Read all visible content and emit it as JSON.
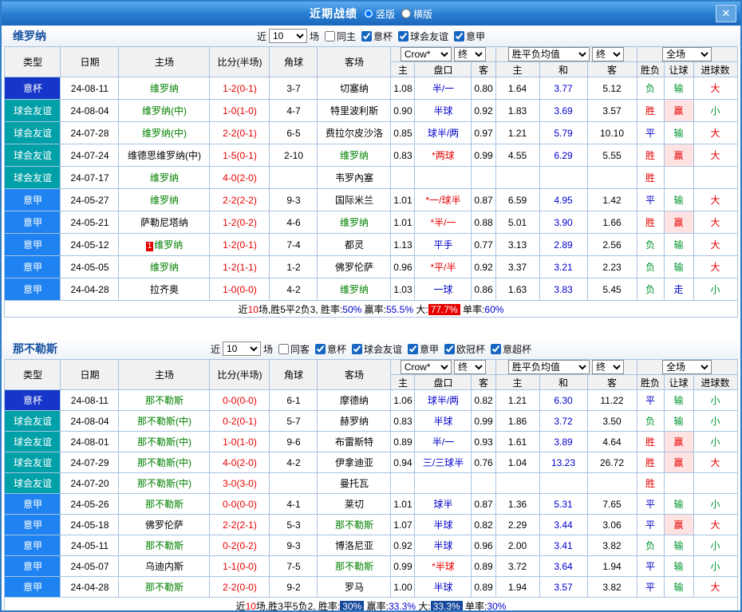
{
  "window": {
    "title": "近期战绩",
    "view_modes": [
      {
        "label": "竖版",
        "selected": true
      },
      {
        "label": "横版",
        "selected": false
      }
    ],
    "close_glyph": "✕"
  },
  "colors": {
    "type_badges": {
      "意杯": "#1536c8",
      "球会友谊": "#00a0a8",
      "意甲": "#1e82f0"
    }
  },
  "table_header": {
    "cols": [
      "类型",
      "日期",
      "主场",
      "比分(半场)",
      "角球",
      "客场"
    ],
    "odds_sub": [
      "主",
      "盘口",
      "客"
    ],
    "avg_sub": [
      "主",
      "和",
      "客"
    ],
    "result_sub": [
      "胜负",
      "让球",
      "进球数"
    ]
  },
  "sections": [
    {
      "team": "维罗纳",
      "filter": {
        "near": "近",
        "count": "10",
        "games": "场",
        "same": "同主",
        "same_checked": false,
        "leagues": [
          {
            "label": "意杯",
            "checked": true
          },
          {
            "label": "球会友谊",
            "checked": true
          },
          {
            "label": "意甲",
            "checked": true
          }
        ]
      },
      "selects": {
        "company": "Crow*",
        "final_a": "终",
        "avg": "胜平负均值",
        "final_b": "终",
        "scope": "全场"
      },
      "rows": [
        {
          "type": "意杯",
          "date": "24-08-11",
          "home": "维罗纳",
          "home_hl": true,
          "score": "1-2(0-1)",
          "corner": "3-7",
          "away": "切塞纳",
          "o1": "1.08",
          "line": "半/一",
          "o2": "0.80",
          "a1": "1.64",
          "a2": "3.77",
          "a3": "5.12",
          "res": "负",
          "let": "输",
          "goal": "大"
        },
        {
          "type": "球会友谊",
          "date": "24-08-04",
          "home": "维罗纳(中)",
          "home_hl": true,
          "score": "1-0(1-0)",
          "corner": "4-7",
          "away": "特里波利斯",
          "o1": "0.90",
          "line": "半球",
          "o2": "0.92",
          "a1": "1.83",
          "a2": "3.69",
          "a3": "3.57",
          "res": "胜",
          "let": "赢",
          "goal": "小"
        },
        {
          "type": "球会友谊",
          "date": "24-07-28",
          "home": "维罗纳(中)",
          "home_hl": true,
          "score": "2-2(0-1)",
          "corner": "6-5",
          "away": "费拉尔皮沙洛",
          "o1": "0.85",
          "line": "球半/两",
          "o2": "0.97",
          "a1": "1.21",
          "a2": "5.79",
          "a3": "10.10",
          "res": "平",
          "let": "输",
          "goal": "大"
        },
        {
          "type": "球会友谊",
          "date": "24-07-24",
          "home": "维德思维罗纳(中)",
          "score": "1-5(0-1)",
          "corner": "2-10",
          "away": "维罗纳",
          "away_hl": true,
          "o1": "0.83",
          "line": "*两球",
          "o2": "0.99",
          "a1": "4.55",
          "a2": "6.29",
          "a3": "5.55",
          "res": "胜",
          "let": "赢",
          "goal": "大"
        },
        {
          "type": "球会友谊",
          "date": "24-07-17",
          "home": "维罗纳",
          "home_hl": true,
          "score": "4-0(2-0)",
          "corner": "",
          "away": "韦罗內塞",
          "res": "胜"
        },
        {
          "type": "意甲",
          "date": "24-05-27",
          "home": "维罗纳",
          "home_hl": true,
          "score": "2-2(2-2)",
          "corner": "9-3",
          "away": "国际米兰",
          "o1": "1.01",
          "line": "*一/球半",
          "o2": "0.87",
          "a1": "6.59",
          "a2": "4.95",
          "a3": "1.42",
          "res": "平",
          "let": "输",
          "goal": "大"
        },
        {
          "type": "意甲",
          "date": "24-05-21",
          "home": "萨勒尼塔纳",
          "score": "1-2(0-2)",
          "corner": "4-6",
          "away": "维罗纳",
          "away_hl": true,
          "o1": "1.01",
          "line": "*半/一",
          "o2": "0.88",
          "a1": "5.01",
          "a2": "3.90",
          "a3": "1.66",
          "res": "胜",
          "let": "赢",
          "goal": "大"
        },
        {
          "type": "意甲",
          "date": "24-05-12",
          "home": "维罗纳",
          "home_hl": true,
          "badge": "1",
          "score": "1-2(0-1)",
          "corner": "7-4",
          "away": "都灵",
          "o1": "1.13",
          "line": "平手",
          "o2": "0.77",
          "a1": "3.13",
          "a2": "2.89",
          "a3": "2.56",
          "res": "负",
          "let": "输",
          "goal": "大"
        },
        {
          "type": "意甲",
          "date": "24-05-05",
          "home": "维罗纳",
          "home_hl": true,
          "score": "1-2(1-1)",
          "corner": "1-2",
          "away": "佛罗伦萨",
          "o1": "0.96",
          "line": "*平/半",
          "o2": "0.92",
          "a1": "3.37",
          "a2": "3.21",
          "a3": "2.23",
          "res": "负",
          "let": "输",
          "goal": "大"
        },
        {
          "type": "意甲",
          "date": "24-04-28",
          "home": "拉齐奥",
          "score": "1-0(0-0)",
          "corner": "4-2",
          "away": "维罗纳",
          "away_hl": true,
          "o1": "1.03",
          "line": "一球",
          "o2": "0.86",
          "a1": "1.63",
          "a2": "3.83",
          "a3": "5.45",
          "res": "负",
          "let": "走",
          "goal": "小"
        }
      ],
      "summary": [
        {
          "t": "近"
        },
        {
          "t": "10",
          "s": "red"
        },
        {
          "t": "场,胜5平2负3, 胜率:"
        },
        {
          "t": "50%",
          "s": "blue"
        },
        {
          "t": " 赢率:"
        },
        {
          "t": "55.5%",
          "s": "blue"
        },
        {
          "t": " 大:"
        },
        {
          "t": "77.7%",
          "s": "redbg"
        },
        {
          "t": " 单率:"
        },
        {
          "t": "60%",
          "s": "blue"
        }
      ]
    },
    {
      "team": "那不勒斯",
      "filter": {
        "near": "近",
        "count": "10",
        "games": "场",
        "same": "同客",
        "same_checked": false,
        "leagues": [
          {
            "label": "意杯",
            "checked": true
          },
          {
            "label": "球会友谊",
            "checked": true
          },
          {
            "label": "意甲",
            "checked": true
          },
          {
            "label": "欧冠杯",
            "checked": true
          },
          {
            "label": "意超杯",
            "checked": true
          }
        ]
      },
      "selects": {
        "company": "Crow*",
        "final_a": "终",
        "avg": "胜平负均值",
        "final_b": "终",
        "scope": "全场"
      },
      "rows": [
        {
          "type": "意杯",
          "date": "24-08-11",
          "home": "那不勒斯",
          "home_hl": true,
          "score": "0-0(0-0)",
          "corner": "6-1",
          "away": "摩德纳",
          "o1": "1.06",
          "line": "球半/两",
          "o2": "0.82",
          "a1": "1.21",
          "a2": "6.30",
          "a3": "11.22",
          "res": "平",
          "let": "输",
          "goal": "小"
        },
        {
          "type": "球会友谊",
          "date": "24-08-04",
          "home": "那不勒斯(中)",
          "home_hl": true,
          "score": "0-2(0-1)",
          "corner": "5-7",
          "away": "赫罗纳",
          "o1": "0.83",
          "line": "半球",
          "o2": "0.99",
          "a1": "1.86",
          "a2": "3.72",
          "a3": "3.50",
          "res": "负",
          "let": "输",
          "goal": "小"
        },
        {
          "type": "球会友谊",
          "date": "24-08-01",
          "home": "那不勒斯(中)",
          "home_hl": true,
          "score": "1-0(1-0)",
          "corner": "9-6",
          "away": "布雷斯特",
          "o1": "0.89",
          "line": "半/一",
          "o2": "0.93",
          "a1": "1.61",
          "a2": "3.89",
          "a3": "4.64",
          "res": "胜",
          "let": "赢",
          "goal": "小"
        },
        {
          "type": "球会友谊",
          "date": "24-07-29",
          "home": "那不勒斯(中)",
          "home_hl": true,
          "score": "4-0(2-0)",
          "corner": "4-2",
          "away": "伊拿迪亚",
          "o1": "0.94",
          "line": "三/三球半",
          "o2": "0.76",
          "a1": "1.04",
          "a2": "13.23",
          "a3": "26.72",
          "res": "胜",
          "let": "赢",
          "goal": "大"
        },
        {
          "type": "球会友谊",
          "date": "24-07-20",
          "home": "那不勒斯(中)",
          "home_hl": true,
          "score": "3-0(3-0)",
          "corner": "",
          "away": "曼托瓦",
          "res": "胜"
        },
        {
          "type": "意甲",
          "date": "24-05-26",
          "home": "那不勒斯",
          "home_hl": true,
          "score": "0-0(0-0)",
          "corner": "4-1",
          "away": "莱切",
          "o1": "1.01",
          "line": "球半",
          "o2": "0.87",
          "a1": "1.36",
          "a2": "5.31",
          "a3": "7.65",
          "res": "平",
          "let": "输",
          "goal": "小"
        },
        {
          "type": "意甲",
          "date": "24-05-18",
          "home": "佛罗伦萨",
          "score": "2-2(2-1)",
          "corner": "5-3",
          "away": "那不勒斯",
          "away_hl": true,
          "o1": "1.07",
          "line": "半球",
          "o2": "0.82",
          "a1": "2.29",
          "a2": "3.44",
          "a3": "3.06",
          "res": "平",
          "let": "赢",
          "goal": "大"
        },
        {
          "type": "意甲",
          "date": "24-05-11",
          "home": "那不勒斯",
          "home_hl": true,
          "score": "0-2(0-2)",
          "corner": "9-3",
          "away": "博洛尼亚",
          "o1": "0.92",
          "line": "半球",
          "o2": "0.96",
          "a1": "2.00",
          "a2": "3.41",
          "a3": "3.82",
          "res": "负",
          "let": "输",
          "goal": "小"
        },
        {
          "type": "意甲",
          "date": "24-05-07",
          "home": "乌迪内斯",
          "score": "1-1(0-0)",
          "corner": "7-5",
          "away": "那不勒斯",
          "away_hl": true,
          "o1": "0.99",
          "line": "*半球",
          "o2": "0.89",
          "a1": "3.72",
          "a2": "3.64",
          "a3": "1.94",
          "res": "平",
          "let": "输",
          "goal": "小"
        },
        {
          "type": "意甲",
          "date": "24-04-28",
          "home": "那不勒斯",
          "home_hl": true,
          "score": "2-2(0-0)",
          "corner": "9-2",
          "away": "罗马",
          "o1": "1.00",
          "line": "半球",
          "o2": "0.89",
          "a1": "1.94",
          "a2": "3.57",
          "a3": "3.82",
          "res": "平",
          "let": "输",
          "goal": "大"
        }
      ],
      "summary": [
        {
          "t": "近"
        },
        {
          "t": "10",
          "s": "red"
        },
        {
          "t": "场,胜3平5负2, 胜率:"
        },
        {
          "t": "30%",
          "s": "bluebg"
        },
        {
          "t": " 赢率:"
        },
        {
          "t": "33.3%",
          "s": "blue"
        },
        {
          "t": " 大:"
        },
        {
          "t": "33.3%",
          "s": "bluebg"
        },
        {
          "t": " 单率:"
        },
        {
          "t": "30%",
          "s": "blue"
        }
      ]
    }
  ]
}
